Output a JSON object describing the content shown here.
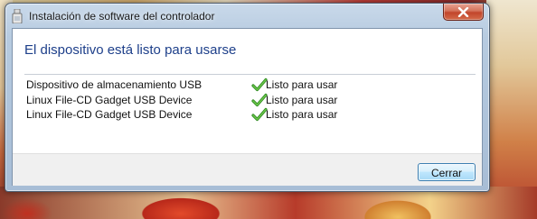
{
  "window": {
    "title": "Instalación de software del controlador"
  },
  "content": {
    "heading": "El dispositivo está listo para usarse",
    "devices": [
      {
        "name": "Dispositivo de almacenamiento USB",
        "status": "Listo para usar",
        "status_icon": "green-checkmark-icon"
      },
      {
        "name": "Linux File-CD Gadget USB Device",
        "status": "Listo para usar",
        "status_icon": "green-checkmark-icon"
      },
      {
        "name": "Linux File-CD Gadget USB Device",
        "status": "Listo para usar",
        "status_icon": "green-checkmark-icon"
      }
    ]
  },
  "footer": {
    "close_label": "Cerrar"
  },
  "colors": {
    "heading": "#1d3f8a",
    "check": "#3a9a2a",
    "close_button_border": "#3c7fb1"
  }
}
